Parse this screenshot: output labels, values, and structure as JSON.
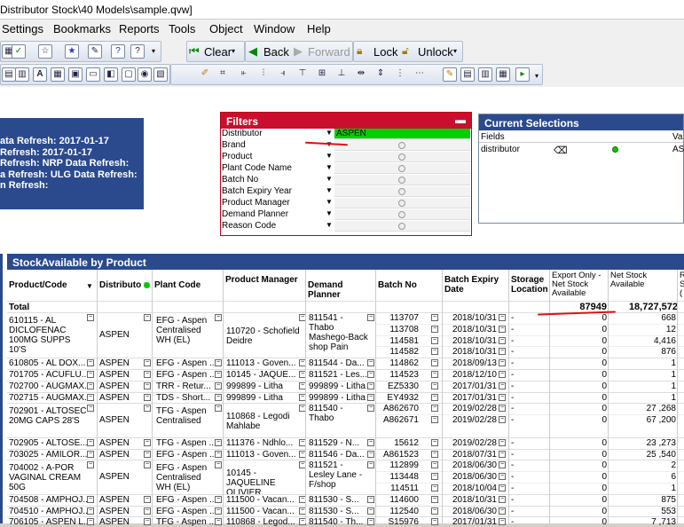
{
  "window": {
    "title": "Distributor Stock\\40 Models\\sample.qvw]"
  },
  "menu": [
    "Settings",
    "Bookmarks",
    "Reports",
    "Tools",
    "Object",
    "Window",
    "Help"
  ],
  "toolbar": {
    "clear": "Clear",
    "back": "Back",
    "forward": "Forward",
    "lock": "Lock",
    "unlock": "Unlock"
  },
  "info": [
    "ata Refresh: 2017-01-17",
    "Refresh: 2017-01-17",
    "Refresh: NRP Data Refresh:",
    "a Refresh: ULG Data Refresh:",
    "n Refresh:"
  ],
  "filters": {
    "title": "Filters",
    "rows": [
      {
        "label": "Distributor",
        "value": "ASPEN"
      },
      {
        "label": "Brand",
        "value": ""
      },
      {
        "label": "Product",
        "value": ""
      },
      {
        "label": "Plant Code Name",
        "value": ""
      },
      {
        "label": "Batch No",
        "value": ""
      },
      {
        "label": "Batch Expiry Year",
        "value": ""
      },
      {
        "label": "Product Manager",
        "value": ""
      },
      {
        "label": "Demand Planner",
        "value": ""
      },
      {
        "label": "Reason Code",
        "value": ""
      }
    ]
  },
  "current_selections": {
    "title": "Current Selections",
    "col_fields": "Fields",
    "col_values": "Va",
    "field": "distributor",
    "value": "AS"
  },
  "table": {
    "title": "StockAvailable  by Product",
    "headers": [
      "Product/Code",
      "Distributo r",
      "Plant Code",
      "Product Manager",
      "Demand Planner",
      "Batch No",
      "Batch Expiry Date",
      "Storage Location",
      "Export Only - Net Stock Available",
      "Net Stock Available",
      "R S ("
    ],
    "total": {
      "label": "Total",
      "export": "87949",
      "net": "18,727,572"
    },
    "rows": [
      {
        "product": "610115 - AL DICLOFENAC 100MG SUPPS 10'S",
        "dist": "ASPEN",
        "plant": "EFG - Aspen Centralised WH (EL)",
        "pm": "110720 - Schofield Deidre",
        "dp": "811541 - Thabo Mashego-Back shop Pain",
        "batches": [
          [
            "113707",
            "2018/10/31",
            "0",
            "668"
          ],
          [
            "113708",
            "2018/10/31",
            "0",
            "12"
          ],
          [
            "114581",
            "2018/10/31",
            "0",
            "4,416"
          ],
          [
            "114582",
            "2018/10/31",
            "0",
            "876"
          ]
        ]
      },
      {
        "product": "610805 - AL DOX...",
        "dist": "ASPEN",
        "plant": "EFG - Aspen ...",
        "pm": "111013 - Goven...",
        "dp": "811544 - Da...",
        "batches": [
          [
            "114862",
            "2018/09/13",
            "0",
            "1"
          ]
        ]
      },
      {
        "product": "701705 - ACUFLU...",
        "dist": "ASPEN",
        "plant": "EFG - Aspen ...",
        "pm": "10145 - JAQUE...",
        "dp": "811521 - Les...",
        "batches": [
          [
            "114523",
            "2018/12/10",
            "0",
            "1"
          ]
        ]
      },
      {
        "product": "702700 - AUGMAX...",
        "dist": "ASPEN",
        "plant": "TRR - Retur...",
        "pm": "999899 - Litha",
        "dp": "999899 - Litha",
        "batches": [
          [
            "EZ5330",
            "2017/01/31",
            "0",
            "1"
          ]
        ]
      },
      {
        "product": "702715 - AUGMAX...",
        "dist": "ASPEN",
        "plant": "TDS - Short...",
        "pm": "999899 - Litha",
        "dp": "999899 - Litha",
        "batches": [
          [
            "EY4932",
            "2017/01/31",
            "0",
            "1"
          ]
        ]
      },
      {
        "product": "702901 - ALTOSEC 20MG CAPS 28'S",
        "dist": "ASPEN",
        "plant": "TFG - Aspen Centralised",
        "pm": "110868 - Legodi Mahlabe",
        "dp": "811540 - Thabo",
        "batches": [
          [
            "A862670",
            "2019/02/28",
            "0",
            "27 ,268"
          ],
          [
            "A862671",
            "2019/02/28",
            "0",
            "67 ,200"
          ]
        ]
      },
      {
        "product": "702905 - ALTOSE...",
        "dist": "ASPEN",
        "plant": "TFG - Aspen ...",
        "pm": "111376 - Ndhlo...",
        "dp": "811529 - N...",
        "batches": [
          [
            "15612",
            "2019/02/28",
            "0",
            "23 ,273"
          ]
        ]
      },
      {
        "product": "703025 - AMILOR...",
        "dist": "ASPEN",
        "plant": "EFG - Aspen ...",
        "pm": "111013 - Goven...",
        "dp": "811546 - Da...",
        "batches": [
          [
            "A861523",
            "2018/07/31",
            "0",
            "25 ,540"
          ]
        ]
      },
      {
        "product": "704002 - A-POR VAGINAL CREAM 50G",
        "dist": "ASPEN",
        "plant": "EFG - Aspen Centralised WH (EL)",
        "pm": "10145 - JAQUELINE OLIVIER",
        "dp": "811521 - Lesley Lane - F/shop",
        "batches": [
          [
            "112899",
            "2018/06/30",
            "0",
            "2"
          ],
          [
            "113448",
            "2018/06/30",
            "0",
            "6"
          ],
          [
            "114511",
            "2018/10/04",
            "0",
            "1"
          ]
        ]
      },
      {
        "product": "704508 - AMPHOJ...",
        "dist": "ASPEN",
        "plant": "EFG - Aspen ...",
        "pm": "111500 - Vacan...",
        "dp": "811530 - S...",
        "batches": [
          [
            "114600",
            "2018/10/31",
            "0",
            "875"
          ]
        ]
      },
      {
        "product": "704510 - AMPHOJ...",
        "dist": "ASPEN",
        "plant": "EFG - Aspen ...",
        "pm": "111500 - Vacan...",
        "dp": "811530 - S...",
        "batches": [
          [
            "112540",
            "2018/06/30",
            "0",
            "553"
          ]
        ]
      },
      {
        "product": "706105 - ASPEN L...",
        "dist": "ASPEN",
        "plant": "TFG - Aspen ...",
        "pm": "110868 - Legod...",
        "dp": "811540 - Th...",
        "batches": [
          [
            "S15976",
            "2017/01/31",
            "0",
            "7 ,713"
          ]
        ]
      }
    ]
  }
}
